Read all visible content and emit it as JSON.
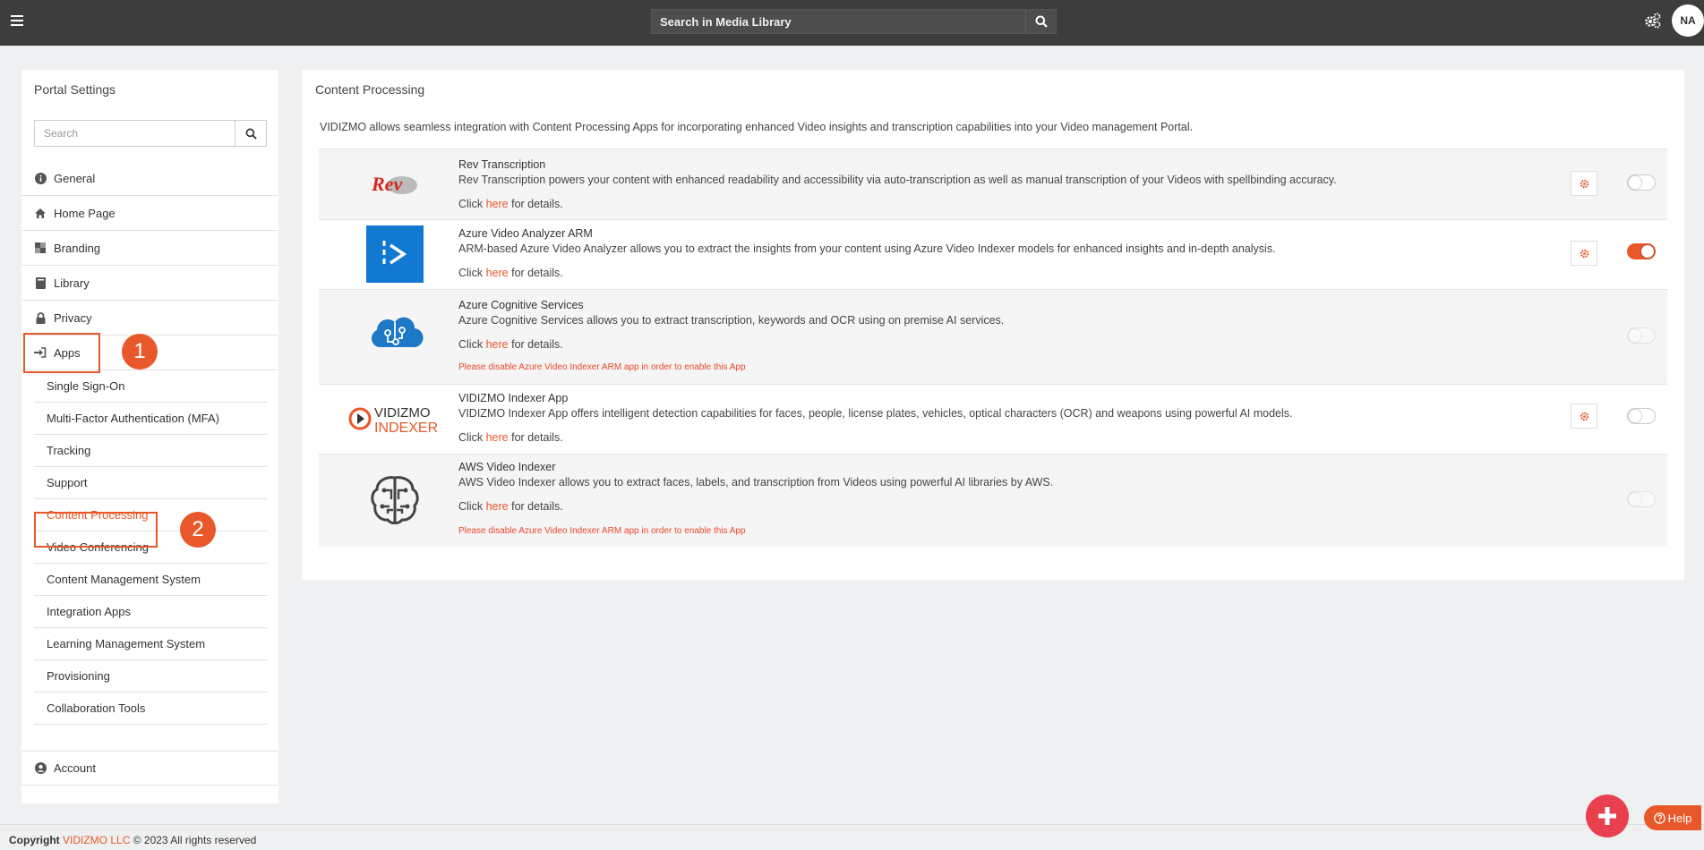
{
  "topbar": {
    "search_placeholder": "Search in Media Library",
    "avatar_initials": "NA"
  },
  "sidebar": {
    "title": "Portal Settings",
    "search_placeholder": "Search",
    "items": [
      {
        "label": "General",
        "icon": "info-icon"
      },
      {
        "label": "Home Page",
        "icon": "home-icon"
      },
      {
        "label": "Branding",
        "icon": "branding-icon"
      },
      {
        "label": "Library",
        "icon": "book-icon"
      },
      {
        "label": "Privacy",
        "icon": "lock-icon"
      },
      {
        "label": "Apps",
        "icon": "sign-in-icon"
      }
    ],
    "subitems": [
      "Single Sign-On",
      "Multi-Factor Authentication (MFA)",
      "Tracking",
      "Support",
      "Content Processing",
      "Video Conferencing",
      "Content Management System",
      "Integration Apps",
      "Learning Management System",
      "Provisioning",
      "Collaboration Tools"
    ],
    "active_subitem": "Content Processing",
    "account_label": "Account"
  },
  "callouts": {
    "one": "1",
    "two": "2"
  },
  "main": {
    "title": "Content Processing",
    "intro": "VIDIZMO allows seamless integration with Content Processing Apps for incorporating enhanced Video insights and transcription capabilities into your Video management Portal.",
    "apps": [
      {
        "name": "Rev Transcription",
        "description": "Rev Transcription powers your content with enhanced readability and accessibility via auto-transcription as well as manual transcription of your Videos with spellbinding accuracy.",
        "click_prefix": "Click",
        "link": "here",
        "click_suffix": "for details.",
        "logo": "rev-logo",
        "logo_text": "Rev",
        "enabled": false,
        "has_settings": true
      },
      {
        "name": "Azure Video Analyzer ARM",
        "description": "ARM-based Azure Video Analyzer allows you to extract the insights from your content using Azure Video Indexer models for enhanced insights and in-depth analysis.",
        "click_prefix": "Click",
        "link": "here",
        "click_suffix": "for details.",
        "logo": "azure-video-analyzer-logo",
        "enabled": true,
        "has_settings": true
      },
      {
        "name": "Azure Cognitive Services",
        "description": "Azure Cognitive Services allows you to extract transcription, keywords and OCR using on premise AI services.",
        "click_prefix": "Click",
        "link": "here",
        "click_suffix": "for details.",
        "warning": "Please disable Azure Video Indexer ARM app in order to enable this App",
        "logo": "azure-cognitive-logo",
        "enabled": false,
        "has_settings": false
      },
      {
        "name": "VIDIZMO Indexer App",
        "description": "VIDIZMO Indexer App offers intelligent detection capabilities for faces, people, license plates, vehicles, optical characters (OCR) and weapons using powerful AI models.",
        "click_prefix": "Click",
        "link": "here",
        "click_suffix": "for details.",
        "logo": "vidizmo-indexer-logo",
        "logo_text_top": "VIDIZMO",
        "logo_text_bottom": "INDEXER",
        "enabled": false,
        "has_settings": true
      },
      {
        "name": "AWS Video Indexer",
        "description": "AWS Video Indexer allows you to extract faces, labels, and transcription from Videos using powerful AI libraries by AWS.",
        "click_prefix": "Click",
        "link": "here",
        "click_suffix": "for details.",
        "warning": "Please disable Azure Video Indexer ARM app in order to enable this App",
        "logo": "aws-brain-logo",
        "enabled": false,
        "has_settings": false
      }
    ]
  },
  "footer": {
    "copyright": "Copyright",
    "company": "VIDIZMO LLC",
    "rest": "© 2023 All rights reserved"
  },
  "help_label": "Help",
  "colors": {
    "accent": "#e8582a",
    "topbar": "#3d3d3d",
    "fab": "#e9404f"
  }
}
